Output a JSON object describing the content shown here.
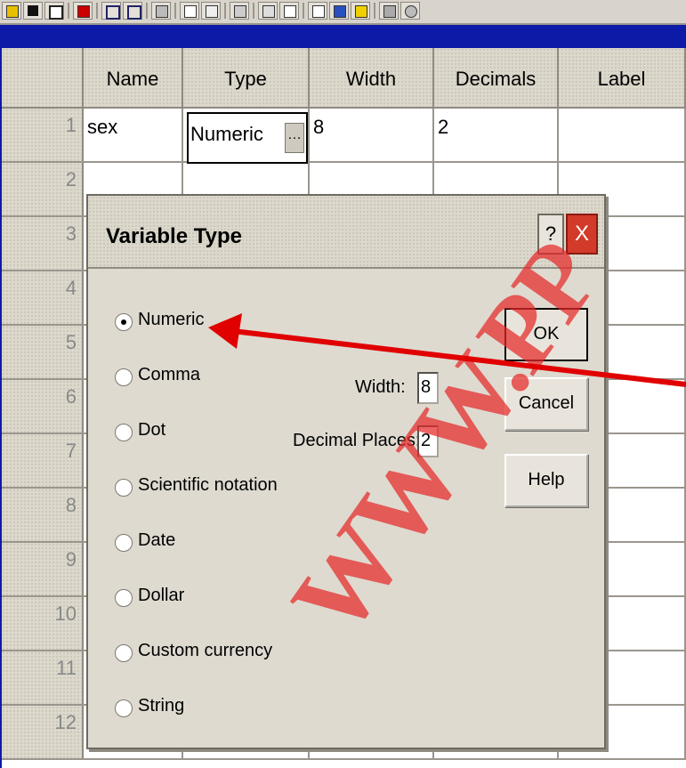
{
  "toolbar": {
    "icons": [
      "open-folder-icon",
      "save-icon",
      "print-icon",
      "dialog-recall-icon",
      "undo-icon",
      "redo-icon",
      "goto-chart-icon",
      "goto-case-icon",
      "variables-icon",
      "find-icon",
      "insert-cases-icon",
      "insert-variable-icon",
      "split-file-icon",
      "weight-cases-icon",
      "select-cases-icon",
      "value-labels-icon",
      "use-sets-icon"
    ]
  },
  "grid": {
    "columns": [
      "Name",
      "Type",
      "Width",
      "Decimals",
      "Label"
    ],
    "rows": [
      {
        "num": "1",
        "name": "sex",
        "type": "Numeric",
        "width": "8",
        "decimals": "2"
      },
      {
        "num": "2"
      },
      {
        "num": "3"
      },
      {
        "num": "4"
      },
      {
        "num": "5"
      },
      {
        "num": "6"
      },
      {
        "num": "7"
      },
      {
        "num": "8"
      },
      {
        "num": "9"
      },
      {
        "num": "10"
      },
      {
        "num": "11"
      },
      {
        "num": "12"
      }
    ]
  },
  "dialog": {
    "title": "Variable Type",
    "help_glyph": "?",
    "close_glyph": "X",
    "options": [
      "Numeric",
      "Comma",
      "Dot",
      "Scientific notation",
      "Date",
      "Dollar",
      "Custom currency",
      "String"
    ],
    "selected": "Numeric",
    "width_label": "Width:",
    "width_value": "8",
    "decimals_label": "Decimal Places:",
    "decimals_value": "2",
    "buttons": {
      "ok": "OK",
      "cancel": "Cancel",
      "help": "Help"
    }
  },
  "watermark": "WWW.PP",
  "colors": {
    "background": "#0d1aa8",
    "arrow": "#e00000",
    "watermark": "#e42828",
    "close": "#d23a2a"
  }
}
